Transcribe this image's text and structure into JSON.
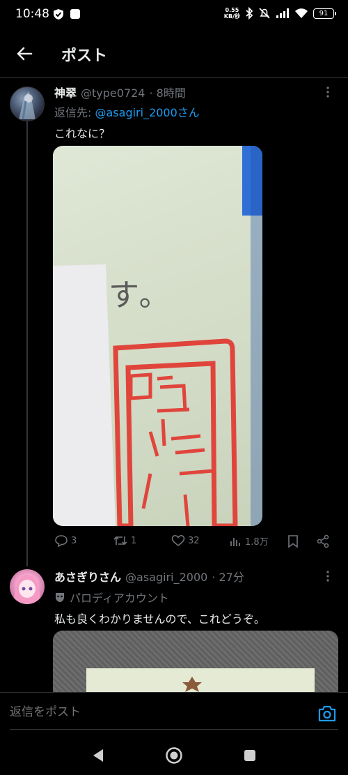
{
  "status_bar": {
    "time": "10:48",
    "net_speed_top": "0.55",
    "net_speed_bottom": "KB/秒",
    "battery": "91"
  },
  "header": {
    "title": "ポスト"
  },
  "tweet1": {
    "name": "神翠",
    "handle": "@type0724",
    "time": "· 8時間",
    "reply_prefix": "返信先:",
    "reply_mention": "@asagiri_2000さん",
    "text": "これなに？",
    "photo_text": "す。",
    "actions": {
      "replies": "3",
      "reposts": "1",
      "likes": "32",
      "views": "1.8万"
    }
  },
  "tweet2": {
    "name": "あさぎりさん",
    "handle": "@asagiri_2000",
    "time": "· 27分",
    "label": "パロディアカウント",
    "text": "私も良くわかりませんので、これどうぞ。"
  },
  "compose": {
    "placeholder": "返信をポスト"
  },
  "colors": {
    "accent": "#1d9bf0",
    "background": "#000000",
    "muted": "#71767b",
    "stamp": "#e0453c"
  }
}
